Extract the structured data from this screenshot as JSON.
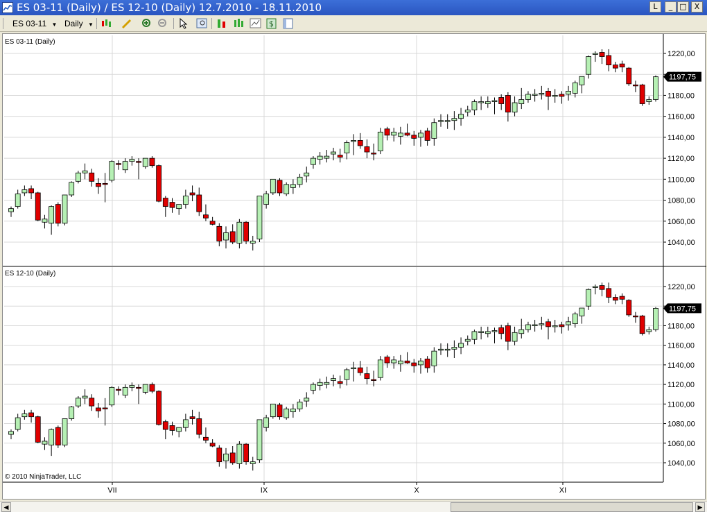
{
  "window": {
    "title": "ES 03-11 (Daily) / ES 12-10 (Daily)  12.7.2010 - 18.11.2010",
    "buttons": [
      "L",
      "_",
      "□",
      "X"
    ]
  },
  "toolbar": {
    "instrument": "ES 03-11",
    "period": "Daily",
    "icons": [
      "bars-type-icon",
      "pencil-icon",
      "zoom-in-icon",
      "zoom-out-icon",
      "cursor-icon",
      "magnifier-icon",
      "chart-properties-icon",
      "indicators-icon",
      "strategies-icon",
      "dollar-icon",
      "panel-icon"
    ]
  },
  "colors": {
    "up": "#b6f0b4",
    "down": "#e00000",
    "grid": "#d8d8d8",
    "text": "#000000"
  },
  "panels": [
    {
      "label": "ES 03-11 (Daily)",
      "last_price": "1197,75"
    },
    {
      "label": "ES 12-10 (Daily)",
      "last_price": "1197,75"
    }
  ],
  "x_axis_labels": [
    "VII",
    "IX",
    "X",
    "XI"
  ],
  "copyright": "© 2010 NinjaTrader, LLC",
  "chart_data": {
    "type": "candlestick",
    "y_ticks": [
      1040,
      1060,
      1080,
      1100,
      1120,
      1140,
      1160,
      1180,
      1200,
      1220
    ],
    "y_tick_labels": [
      "1040,00",
      "1060,00",
      "1080,00",
      "1100,00",
      "1120,00",
      "1140,00",
      "1160,00",
      "1180,00",
      "1200,00",
      "1220,00"
    ],
    "ylim": [
      1028,
      1230
    ],
    "grid": true,
    "candles": [
      [
        1069,
        1074,
        1064,
        1072
      ],
      [
        1074,
        1090,
        1072,
        1086
      ],
      [
        1087,
        1094,
        1084,
        1090
      ],
      [
        1091,
        1094,
        1081,
        1087
      ],
      [
        1087,
        1088,
        1060,
        1061
      ],
      [
        1059,
        1066,
        1053,
        1062
      ],
      [
        1058,
        1075,
        1047,
        1074
      ],
      [
        1076,
        1078,
        1055,
        1058
      ],
      [
        1058,
        1084,
        1056,
        1085
      ],
      [
        1085,
        1098,
        1083,
        1097
      ],
      [
        1098,
        1108,
        1096,
        1106
      ],
      [
        1106,
        1115,
        1100,
        1108
      ],
      [
        1106,
        1110,
        1093,
        1098
      ],
      [
        1096,
        1101,
        1086,
        1093
      ],
      [
        1096,
        1106,
        1078,
        1095
      ],
      [
        1099,
        1118,
        1097,
        1117
      ],
      [
        1115,
        1118,
        1109,
        1114
      ],
      [
        1109,
        1120,
        1106,
        1117
      ],
      [
        1117,
        1122,
        1113,
        1119
      ],
      [
        1117,
        1120,
        1100,
        1116
      ],
      [
        1112,
        1120,
        1110,
        1120
      ],
      [
        1120,
        1122,
        1111,
        1113
      ],
      [
        1113,
        1114,
        1078,
        1079
      ],
      [
        1082,
        1084,
        1064,
        1074
      ],
      [
        1078,
        1082,
        1068,
        1073
      ],
      [
        1072,
        1075,
        1066,
        1076
      ],
      [
        1076,
        1090,
        1072,
        1084
      ],
      [
        1087,
        1094,
        1079,
        1085
      ],
      [
        1085,
        1092,
        1065,
        1069
      ],
      [
        1066,
        1076,
        1060,
        1063
      ],
      [
        1060,
        1064,
        1056,
        1057
      ],
      [
        1055,
        1058,
        1036,
        1041
      ],
      [
        1042,
        1055,
        1034,
        1049
      ],
      [
        1050,
        1057,
        1038,
        1040
      ],
      [
        1039,
        1062,
        1034,
        1059
      ],
      [
        1059,
        1060,
        1038,
        1041
      ],
      [
        1039,
        1046,
        1032,
        1041
      ],
      [
        1043,
        1080,
        1040,
        1084
      ],
      [
        1076,
        1089,
        1072,
        1086
      ],
      [
        1087,
        1100,
        1085,
        1100
      ],
      [
        1099,
        1101,
        1084,
        1087
      ],
      [
        1086,
        1097,
        1084,
        1095
      ],
      [
        1092,
        1100,
        1086,
        1095
      ],
      [
        1095,
        1105,
        1092,
        1102
      ],
      [
        1103,
        1112,
        1097,
        1106
      ],
      [
        1114,
        1122,
        1110,
        1120
      ],
      [
        1119,
        1126,
        1114,
        1122
      ],
      [
        1120,
        1128,
        1116,
        1122
      ],
      [
        1124,
        1130,
        1118,
        1126
      ],
      [
        1123,
        1129,
        1116,
        1121
      ],
      [
        1125,
        1137,
        1119,
        1135
      ],
      [
        1136,
        1143,
        1123,
        1137
      ],
      [
        1137,
        1144,
        1129,
        1132
      ],
      [
        1131,
        1138,
        1120,
        1126
      ],
      [
        1125,
        1134,
        1118,
        1124
      ],
      [
        1127,
        1149,
        1124,
        1145
      ],
      [
        1148,
        1150,
        1137,
        1142
      ],
      [
        1142,
        1149,
        1136,
        1145
      ],
      [
        1141,
        1150,
        1133,
        1144
      ],
      [
        1144,
        1153,
        1141,
        1142
      ],
      [
        1142,
        1146,
        1132,
        1139
      ],
      [
        1140,
        1147,
        1131,
        1144
      ],
      [
        1146,
        1149,
        1132,
        1137
      ],
      [
        1139,
        1158,
        1132,
        1154
      ],
      [
        1155,
        1162,
        1150,
        1156
      ],
      [
        1155,
        1162,
        1148,
        1156
      ],
      [
        1156,
        1165,
        1147,
        1158
      ],
      [
        1158,
        1168,
        1151,
        1162
      ],
      [
        1164,
        1170,
        1160,
        1166
      ],
      [
        1166,
        1176,
        1161,
        1174
      ],
      [
        1174,
        1179,
        1166,
        1174
      ],
      [
        1172,
        1179,
        1168,
        1174
      ],
      [
        1174,
        1178,
        1162,
        1175
      ],
      [
        1178,
        1181,
        1166,
        1172
      ],
      [
        1180,
        1183,
        1155,
        1164
      ],
      [
        1164,
        1179,
        1160,
        1173
      ],
      [
        1172,
        1187,
        1167,
        1176
      ],
      [
        1176,
        1184,
        1173,
        1181
      ],
      [
        1180,
        1186,
        1174,
        1181
      ],
      [
        1182,
        1189,
        1176,
        1182
      ],
      [
        1184,
        1187,
        1166,
        1179
      ],
      [
        1179,
        1186,
        1173,
        1180
      ],
      [
        1181,
        1184,
        1172,
        1179
      ],
      [
        1181,
        1189,
        1175,
        1184
      ],
      [
        1182,
        1194,
        1178,
        1192
      ],
      [
        1190,
        1198,
        1182,
        1198
      ],
      [
        1200,
        1218,
        1196,
        1217
      ],
      [
        1219,
        1222,
        1212,
        1220
      ],
      [
        1221,
        1224,
        1210,
        1217
      ],
      [
        1218,
        1224,
        1203,
        1209
      ],
      [
        1209,
        1212,
        1202,
        1206
      ],
      [
        1210,
        1213,
        1202,
        1207
      ],
      [
        1206,
        1207,
        1189,
        1191
      ],
      [
        1190,
        1194,
        1183,
        1189
      ],
      [
        1190,
        1191,
        1170,
        1172
      ],
      [
        1174,
        1179,
        1171,
        1176
      ],
      [
        1176,
        1199,
        1174,
        1197.75
      ]
    ]
  }
}
